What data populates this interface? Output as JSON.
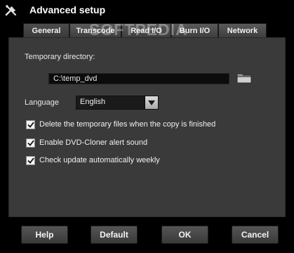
{
  "window": {
    "title": "Advanced setup",
    "icon": "tools-icon"
  },
  "watermark": "SOFTPEDIA",
  "tabs": [
    {
      "label": "General",
      "active": true
    },
    {
      "label": "Transcode",
      "active": false
    },
    {
      "label": "Read I/O",
      "active": false
    },
    {
      "label": "Burn I/O",
      "active": false
    },
    {
      "label": "Network",
      "active": false
    }
  ],
  "general": {
    "temp_dir_label": "Temporary directory:",
    "temp_dir_value": "C:\\temp_dvd",
    "browse_icon": "folder-icon",
    "language_label": "Language",
    "language_value": "English",
    "checkboxes": [
      {
        "label": "Delete the temporary files when the copy is finished",
        "checked": true
      },
      {
        "label": "Enable DVD-Cloner alert sound",
        "checked": true
      },
      {
        "label": "Check update automatically weekly",
        "checked": true
      }
    ]
  },
  "buttons": {
    "help": "Help",
    "default": "Default",
    "ok": "OK",
    "cancel": "Cancel"
  }
}
